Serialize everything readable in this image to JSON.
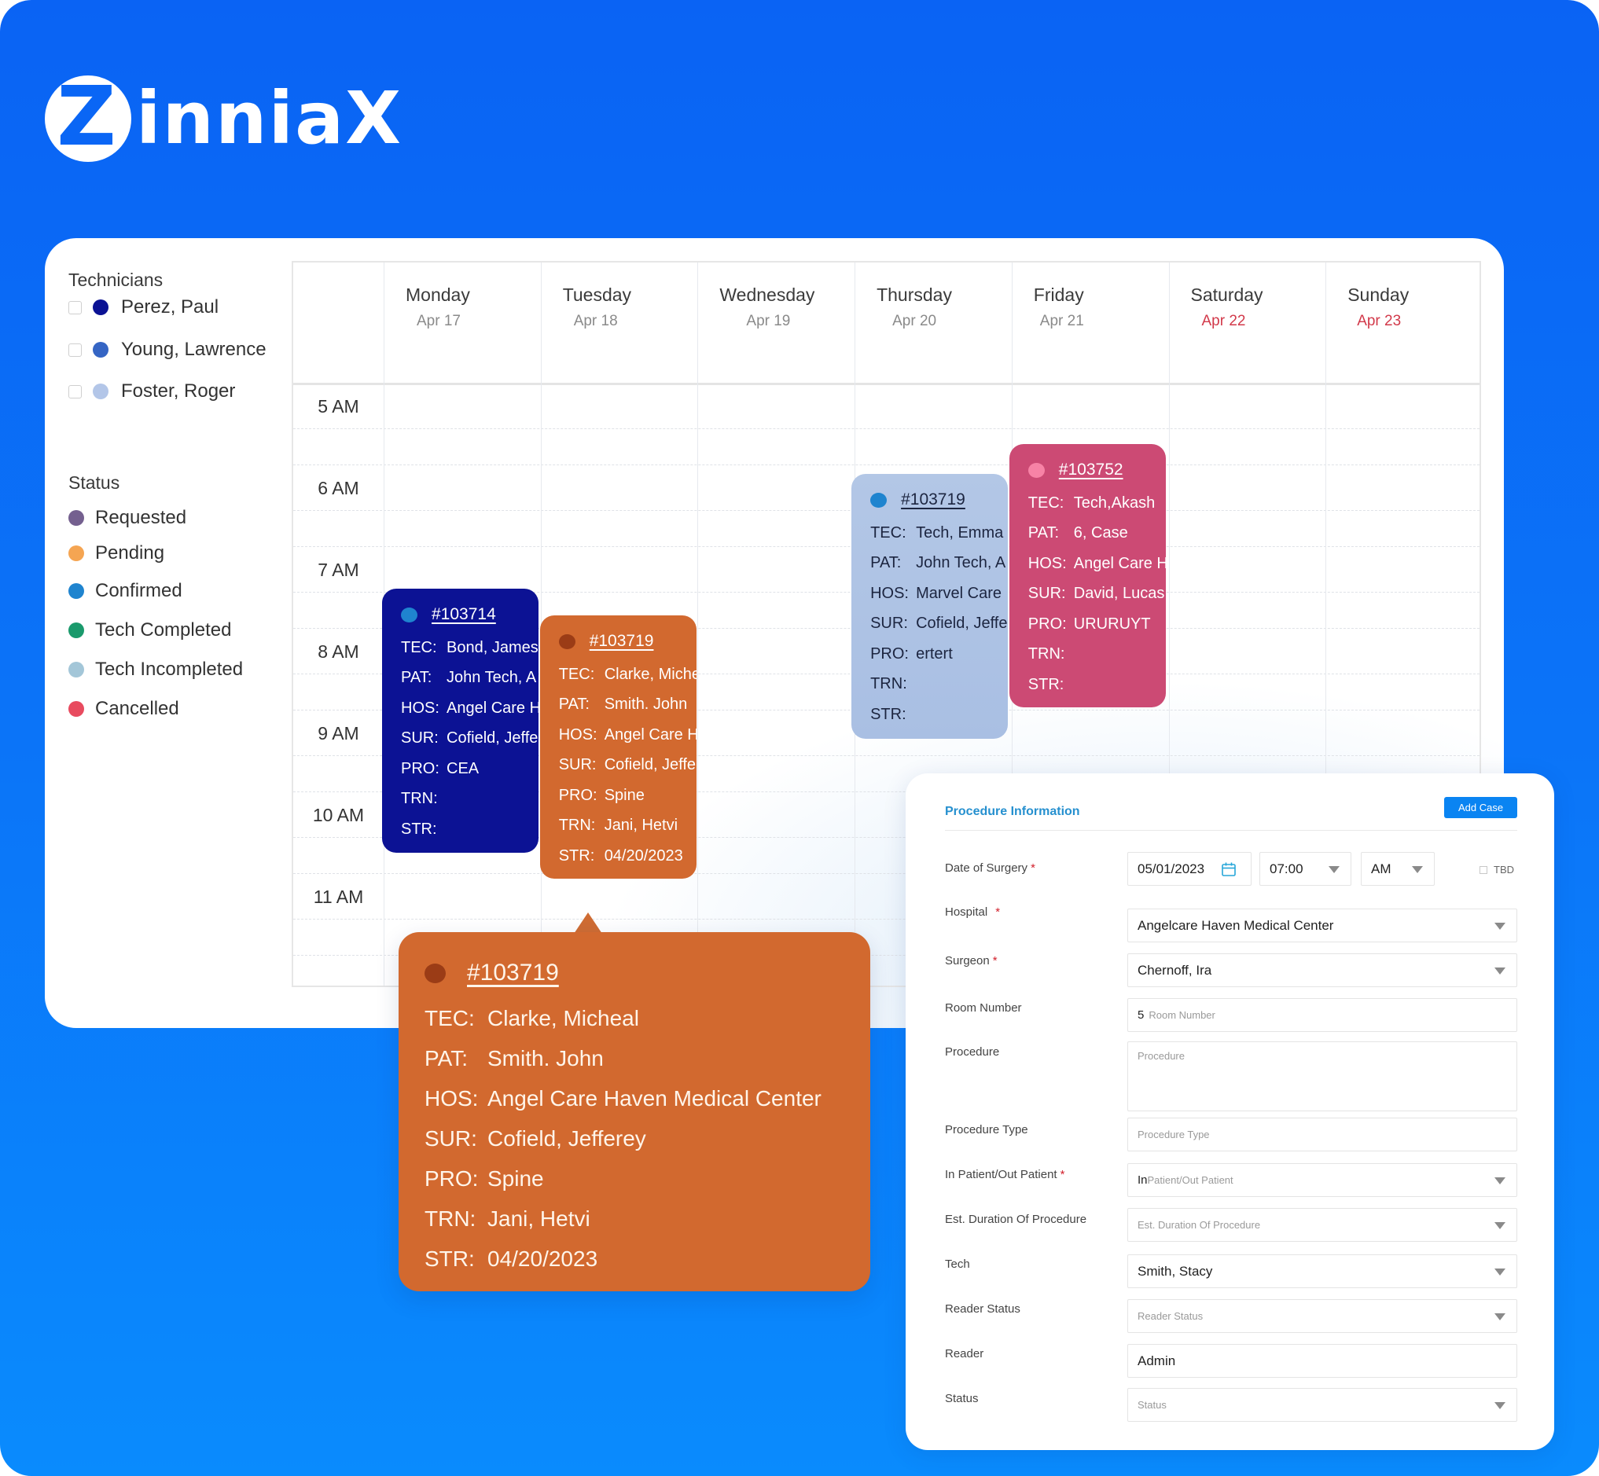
{
  "brand": {
    "logo_letter": "Z",
    "logo_text": "inniaX"
  },
  "sidebar": {
    "technicians_heading": "Technicians",
    "technicians": [
      {
        "name": "Perez, Paul",
        "color": "#0b1294",
        "checked": false
      },
      {
        "name": "Young, Lawrence",
        "color": "#3565c4",
        "checked": false
      },
      {
        "name": "Foster, Roger",
        "color": "#b3c6e8",
        "checked": false
      }
    ],
    "status_heading": "Status",
    "statuses": [
      {
        "label": "Requested",
        "color": "#74608f"
      },
      {
        "label": "Pending",
        "color": "#f5a552"
      },
      {
        "label": "Confirmed",
        "color": "#1f84cf"
      },
      {
        "label": "Tech Completed",
        "color": "#1a9a6c"
      },
      {
        "label": "Tech Incompleted",
        "color": "#a3c6d8"
      },
      {
        "label": "Cancelled",
        "color": "#e84b5f"
      }
    ]
  },
  "calendar": {
    "days": [
      {
        "name": "Monday",
        "date": "Apr 17",
        "weekend": false
      },
      {
        "name": "Tuesday",
        "date": "Apr 18",
        "weekend": false
      },
      {
        "name": "Wednesday",
        "date": "Apr 19",
        "weekend": false
      },
      {
        "name": "Thursday",
        "date": "Apr 20",
        "weekend": false
      },
      {
        "name": "Friday",
        "date": "Apr 21",
        "weekend": false
      },
      {
        "name": "Saturday",
        "date": "Apr 22",
        "weekend": true
      },
      {
        "name": "Sunday",
        "date": "Apr 23",
        "weekend": true
      }
    ],
    "hours": [
      "5 AM",
      "6 AM",
      "7 AM",
      "8 AM",
      "9 AM",
      "10 AM",
      "11 AM"
    ],
    "field_keys": [
      "TEC:",
      "PAT:",
      "HOS:",
      "SUR:",
      "PRO:",
      "TRN:",
      "STR:"
    ],
    "events": [
      {
        "id": "#103714",
        "day": "Monday",
        "bg": "#0c1294",
        "dot": "#1f84cf",
        "text_color": "light",
        "fields": [
          "Bond, James",
          "John Tech, A",
          "Angel Care Haven Medical Center",
          "Cofield, Jefferey",
          "CEA",
          "",
          ""
        ]
      },
      {
        "id": "#103719",
        "day": "Tuesday",
        "bg": "#d2692f",
        "dot": "#9b3c16",
        "text_color": "light",
        "fields": [
          "Clarke, Micheal",
          "Smith. John",
          "Angel Care Haven Medical Center",
          "Cofield, Jefferey",
          "Spine",
          "Jani, Hetvi",
          "04/20/2023"
        ]
      },
      {
        "id": "#103719",
        "day": "Thursday",
        "bg": "#aec3e4",
        "dot": "#1f84cf",
        "text_color": "dark",
        "fields": [
          "Tech, Emma",
          "John Tech, A",
          "Marvel Care",
          "Cofield, Jefferey",
          "ertert",
          "",
          ""
        ]
      },
      {
        "id": "#103752",
        "day": "Friday",
        "bg": "#cc4a74",
        "dot": "#f783a6",
        "text_color": "light",
        "fields": [
          "Tech,Akash",
          "6, Case",
          "Angel Care Haven Medical Center",
          "David, Lucas",
          "URURUYT",
          "",
          ""
        ]
      }
    ]
  },
  "tooltip": {
    "id": "#103719",
    "fields": [
      {
        "key": "TEC:",
        "value": "Clarke, Micheal"
      },
      {
        "key": "PAT:",
        "value": "Smith. John"
      },
      {
        "key": "HOS:",
        "value": "Angel Care Haven Medical Center"
      },
      {
        "key": "SUR:",
        "value": "Cofield, Jefferey"
      },
      {
        "key": "PRO:",
        "value": "Spine"
      },
      {
        "key": "TRN:",
        "value": "Jani, Hetvi"
      },
      {
        "key": "STR:",
        "value": "04/20/2023"
      }
    ]
  },
  "form": {
    "title": "Procedure Information",
    "add_case_label": "Add Case",
    "date_label": "Date of Surgery",
    "date_value": "05/01/2023",
    "time_value": "07:00",
    "ampm_value": "AM",
    "tbd_label": "TBD",
    "hospital_label": "Hospital",
    "hospital_value": "Angelcare Haven Medical Center",
    "surgeon_label": "Surgeon",
    "surgeon_value": "Chernoff, Ira",
    "room_label": "Room Number",
    "room_value": "5",
    "room_placeholder": "Room Number",
    "procedure_label": "Procedure",
    "procedure_placeholder": "Procedure",
    "procedure_type_label": "Procedure Type",
    "procedure_type_placeholder": "Procedure Type",
    "inout_label": "In Patient/Out Patient",
    "inout_value": "In",
    "inout_placeholder": "Patient/Out Patient",
    "duration_label": "Est. Duration Of Procedure",
    "duration_placeholder": "Est. Duration Of Procedure",
    "tech_label": "Tech",
    "tech_value": "Smith, Stacy",
    "reader_status_label": "Reader Status",
    "reader_status_placeholder": "Reader Status",
    "reader_label": "Reader",
    "reader_value": "Admin",
    "status_label": "Status",
    "status_placeholder": "Status",
    "required_mark": "*",
    "accent_color": "#2690cf"
  }
}
